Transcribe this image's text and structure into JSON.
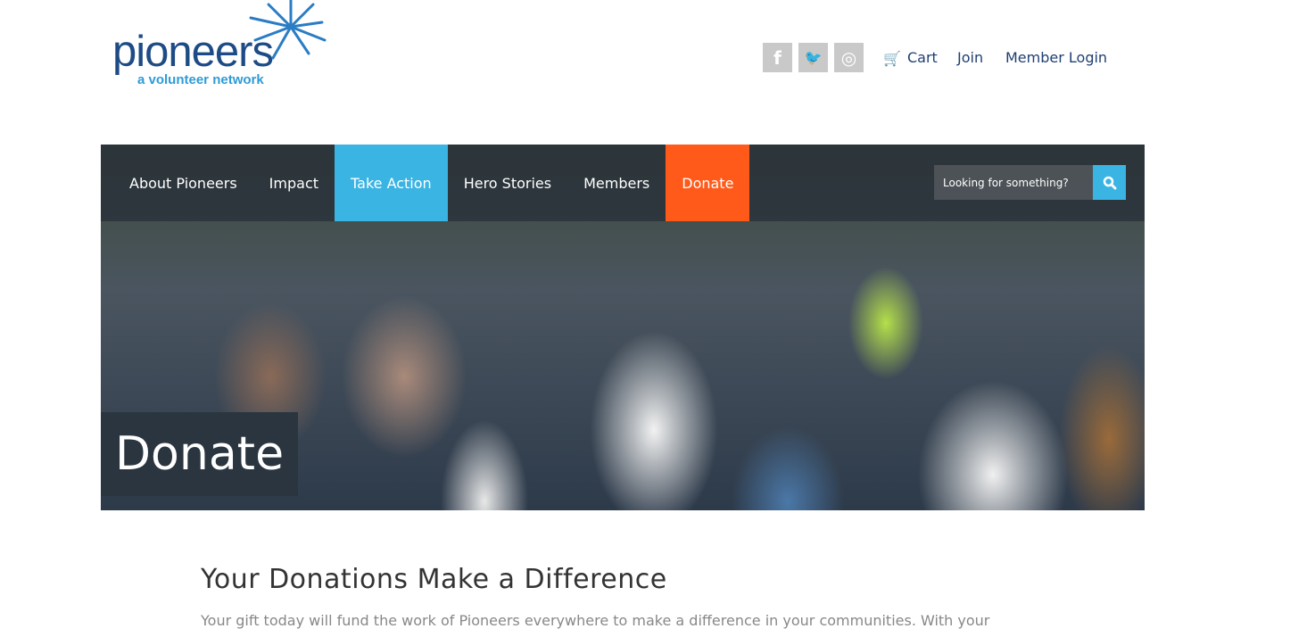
{
  "logo": {
    "word": "pioneers",
    "tagline": "a volunteer network"
  },
  "header": {
    "social": [
      {
        "icon": "facebook-icon",
        "glyph": "f"
      },
      {
        "icon": "twitter-icon",
        "glyph": "🐦"
      },
      {
        "icon": "instagram-icon",
        "glyph": "◎"
      }
    ],
    "cart": "Cart",
    "join": "Join",
    "login": "Member Login"
  },
  "nav": {
    "items": [
      "About Pioneers",
      "Impact",
      "Take Action",
      "Hero Stories",
      "Members",
      "Donate"
    ],
    "active": "Take Action",
    "search_placeholder": "Looking for something?"
  },
  "hero": {
    "title": "Donate"
  },
  "main": {
    "heading": "Your Donations Make a Difference",
    "body": "Your gift today will fund the work of Pioneers everywhere to make a difference in your communities. With your"
  },
  "colors": {
    "brand": "#1d4b85",
    "accent": "#3ab4e3",
    "donate": "#ff5a1a"
  }
}
